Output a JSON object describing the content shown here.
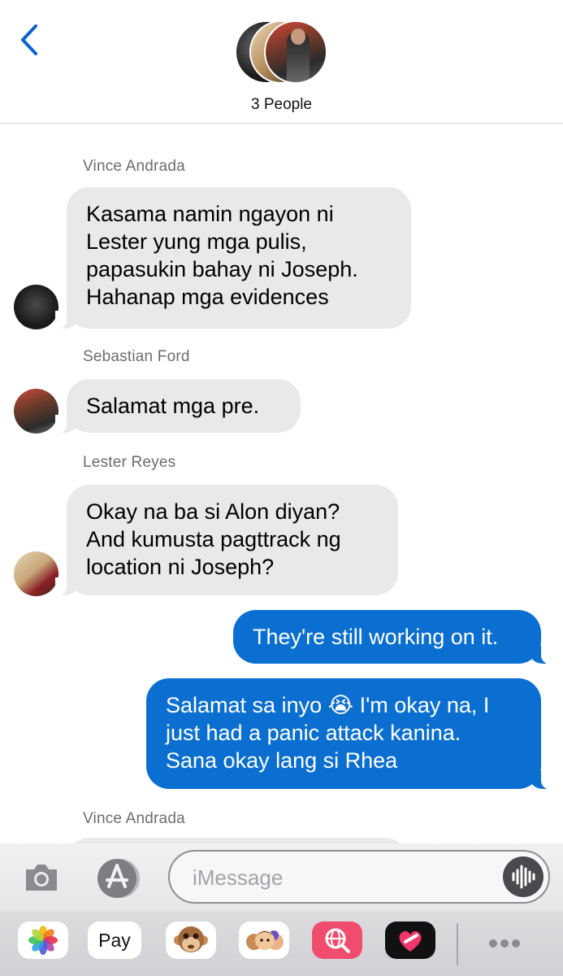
{
  "header": {
    "group_title": "3 People"
  },
  "messages": [
    {
      "sender": "Vince Andrada",
      "text": "Kasama namin ngayon ni\nLester yung mga pulis,\npapasukin bahay ni Joseph.\nHahanap mga evidences",
      "type": "received"
    },
    {
      "sender": "Sebastian Ford",
      "text": "Salamat mga pre.",
      "type": "received"
    },
    {
      "sender": "Lester Reyes",
      "text": "Okay na ba si Alon diyan?\nAnd kumusta pagttrack ng\nlocation ni Joseph?",
      "type": "received"
    },
    {
      "text": "They're still working on it.",
      "type": "sent"
    },
    {
      "text": "Salamat sa inyo 😭 I'm okay na, I\njust had a panic attack kanina.\nSana okay lang si Rhea",
      "type": "sent"
    },
    {
      "sender": "Vince Andrada",
      "type": "received"
    }
  ],
  "input": {
    "placeholder": "iMessage"
  },
  "drawer": {
    "pay_label": "Pay",
    "apple_glyph": ""
  },
  "colors": {
    "sent_bubble": "#0b6fd1",
    "received_bubble": "#e9e9eb",
    "accent": "#0a62d0"
  }
}
